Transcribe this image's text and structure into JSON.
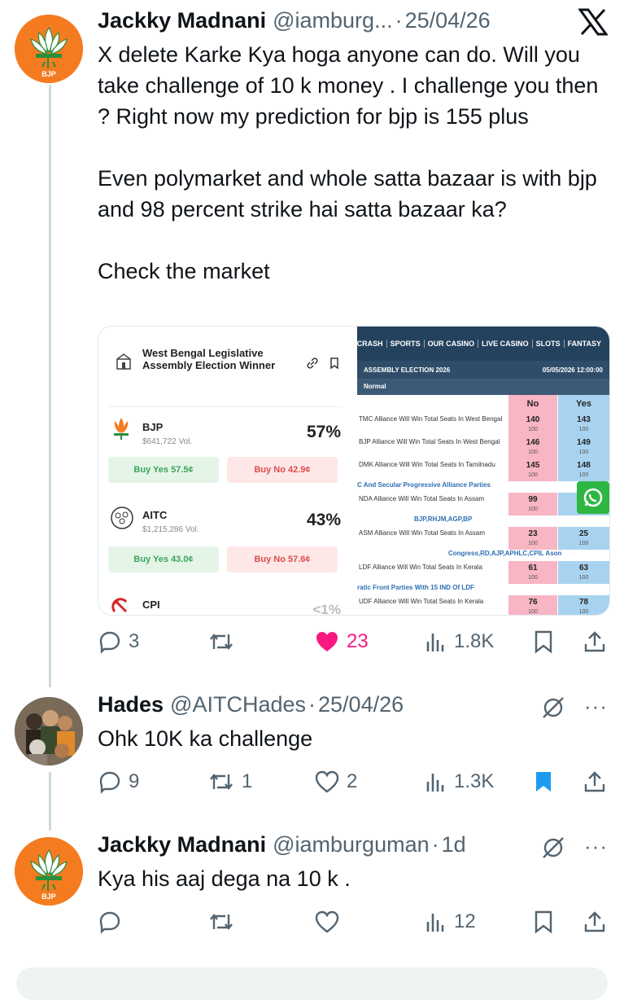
{
  "tweet1": {
    "name": "Jackky Madnani",
    "handle": "@iamburg...",
    "dot": "·",
    "date": "25/04/26",
    "text": "X delete Karke Kya hoga anyone can do. Will you take challenge of 10 k money . I challenge you then ? Right now my prediction for bjp is 155 plus\n\nEven polymarket and whole satta bazaar is with bjp and 98 percent strike hai satta bazaar ka?\n\nCheck the market",
    "avatar_label": "BJP",
    "embed": {
      "polymarket": {
        "title": "West Bengal Legislative Assembly Election Winner",
        "rows": [
          {
            "name": "BJP",
            "vol": "$641,722 Vol.",
            "pct": "57%",
            "yes": "Buy Yes 57.5¢",
            "no": "Buy No 42.9¢"
          },
          {
            "name": "AITC",
            "vol": "$1,215,286 Vol.",
            "pct": "43%",
            "yes": "Buy Yes 43.0¢",
            "no": "Buy No 57.6¢"
          },
          {
            "name": "CPI",
            "pct": "<1%"
          }
        ]
      },
      "betting": {
        "nav": [
          "CRASH",
          "SPORTS",
          "OUR CASINO",
          "LIVE CASINO",
          "SLOTS",
          "FANTASY"
        ],
        "event": "ASSEMBLY ELECTION 2026",
        "datetime": "05/05/2026 12:00:00",
        "sub": "Normal",
        "col_no": "No",
        "col_yes": "Yes",
        "rows": [
          {
            "q": "TMC Alliance Will Win Total Seats In West Bengal",
            "no": "140",
            "no_s": "100",
            "yes": "143",
            "yes_s": "100"
          },
          {
            "q": "BJP Alliance Will Win Total Seats In West Bengal",
            "no": "146",
            "no_s": "100",
            "yes": "149",
            "yes_s": "100"
          },
          {
            "q": "DMK Alliance Will Win Total Seats In Tamilnadu",
            "no": "145",
            "no_s": "100",
            "yes": "148",
            "yes_s": "100"
          },
          {
            "q": "NDA Alliance Will Win Total Seats In Assam",
            "no": "99",
            "no_s": "100",
            "yes": "",
            "yes_s": ""
          },
          {
            "q": "ASM Alliance Will Win Total Seats In Assam",
            "no": "23",
            "no_s": "100",
            "yes": "25",
            "yes_s": "100"
          },
          {
            "q": "LDF Alliance Will Win Total Seats In Kerala",
            "no": "61",
            "no_s": "100",
            "yes": "63",
            "yes_s": "100"
          },
          {
            "q": "UDF Alliance Will Win Total Seats In Kerala",
            "no": "76",
            "no_s": "100",
            "yes": "78",
            "yes_s": "100"
          }
        ],
        "sections": [
          "C And Secular Progressive Alliance Parties",
          "BJP,RHJM,AGP,BP",
          "Congress,RD,AJP,APHLC,CPIL Ason",
          "ratic Front Parties With 15 IND Of LDF"
        ]
      }
    },
    "actions": {
      "reply": "3",
      "retweet": "",
      "like": "23",
      "views": "1.8K"
    }
  },
  "tweet2": {
    "name": "Hades",
    "handle": "@AITCHades",
    "dot": "·",
    "date": "25/04/26",
    "text": "Ohk 10K ka challenge",
    "actions": {
      "reply": "9",
      "retweet": "1",
      "like": "2",
      "views": "1.3K"
    }
  },
  "tweet3": {
    "name": "Jackky Madnani",
    "handle": "@iamburguman",
    "dot": "·",
    "date": "1d",
    "text": "Kya his aaj dega na 10 k .",
    "avatar_label": "BJP",
    "actions": {
      "reply": "",
      "retweet": "",
      "like": "",
      "views": "12"
    }
  },
  "more_label": "···",
  "colors": {
    "like": "#f91880",
    "bookmark_active": "#1d9bf0",
    "muted": "#536471",
    "thread": "#cfd9de"
  }
}
